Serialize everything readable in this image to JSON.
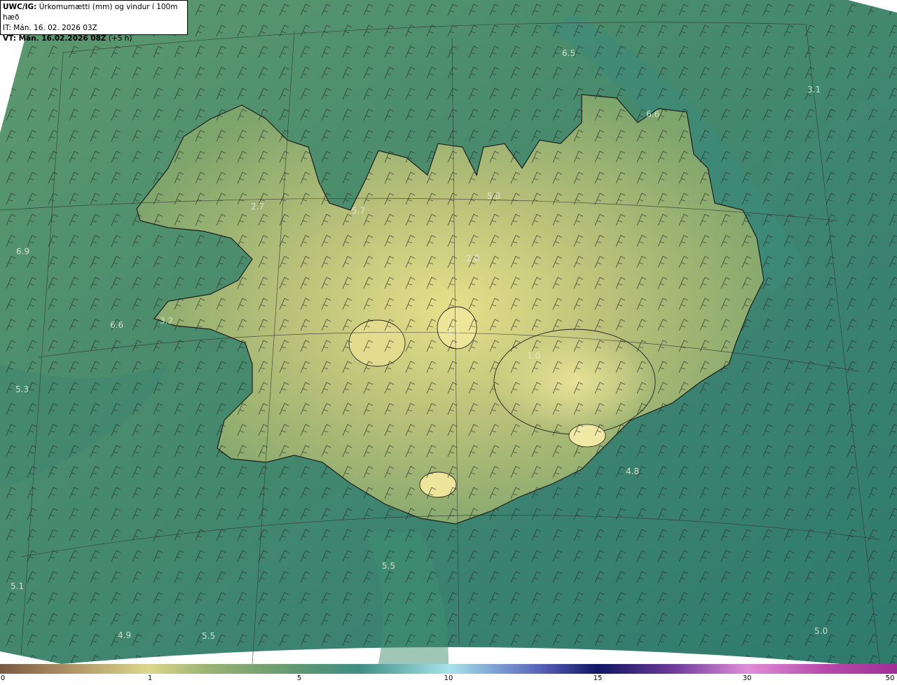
{
  "header": {
    "product": "UWC/IG:",
    "title": "Úrkomumætti (mm) og vindur í 100m hæð",
    "it_line": "IT: Mán. 16. 02. 2026 03Z",
    "vt_label": "VT: Mán. 16.02.2026 08Z",
    "vt_offset": "(+5 h)"
  },
  "map_values": [
    "6.5",
    "3.1",
    "6.6",
    "5.8",
    "5.7",
    "2.7",
    "6.9",
    "2.0",
    "3.2",
    "6.6",
    "1.1",
    "1.0",
    "5.3",
    "4.8",
    "5.5",
    "5.1",
    "4.9",
    "5.5",
    "5.0"
  ],
  "scale": {
    "ticks": [
      "0",
      "1",
      "5",
      "10",
      "15",
      "30",
      "50"
    ],
    "colors": [
      "#7a5a43",
      "#dcd78c",
      "#5f9872",
      "#a8e3ea",
      "#101664",
      "#e08ed8",
      "#a02f94"
    ]
  }
}
